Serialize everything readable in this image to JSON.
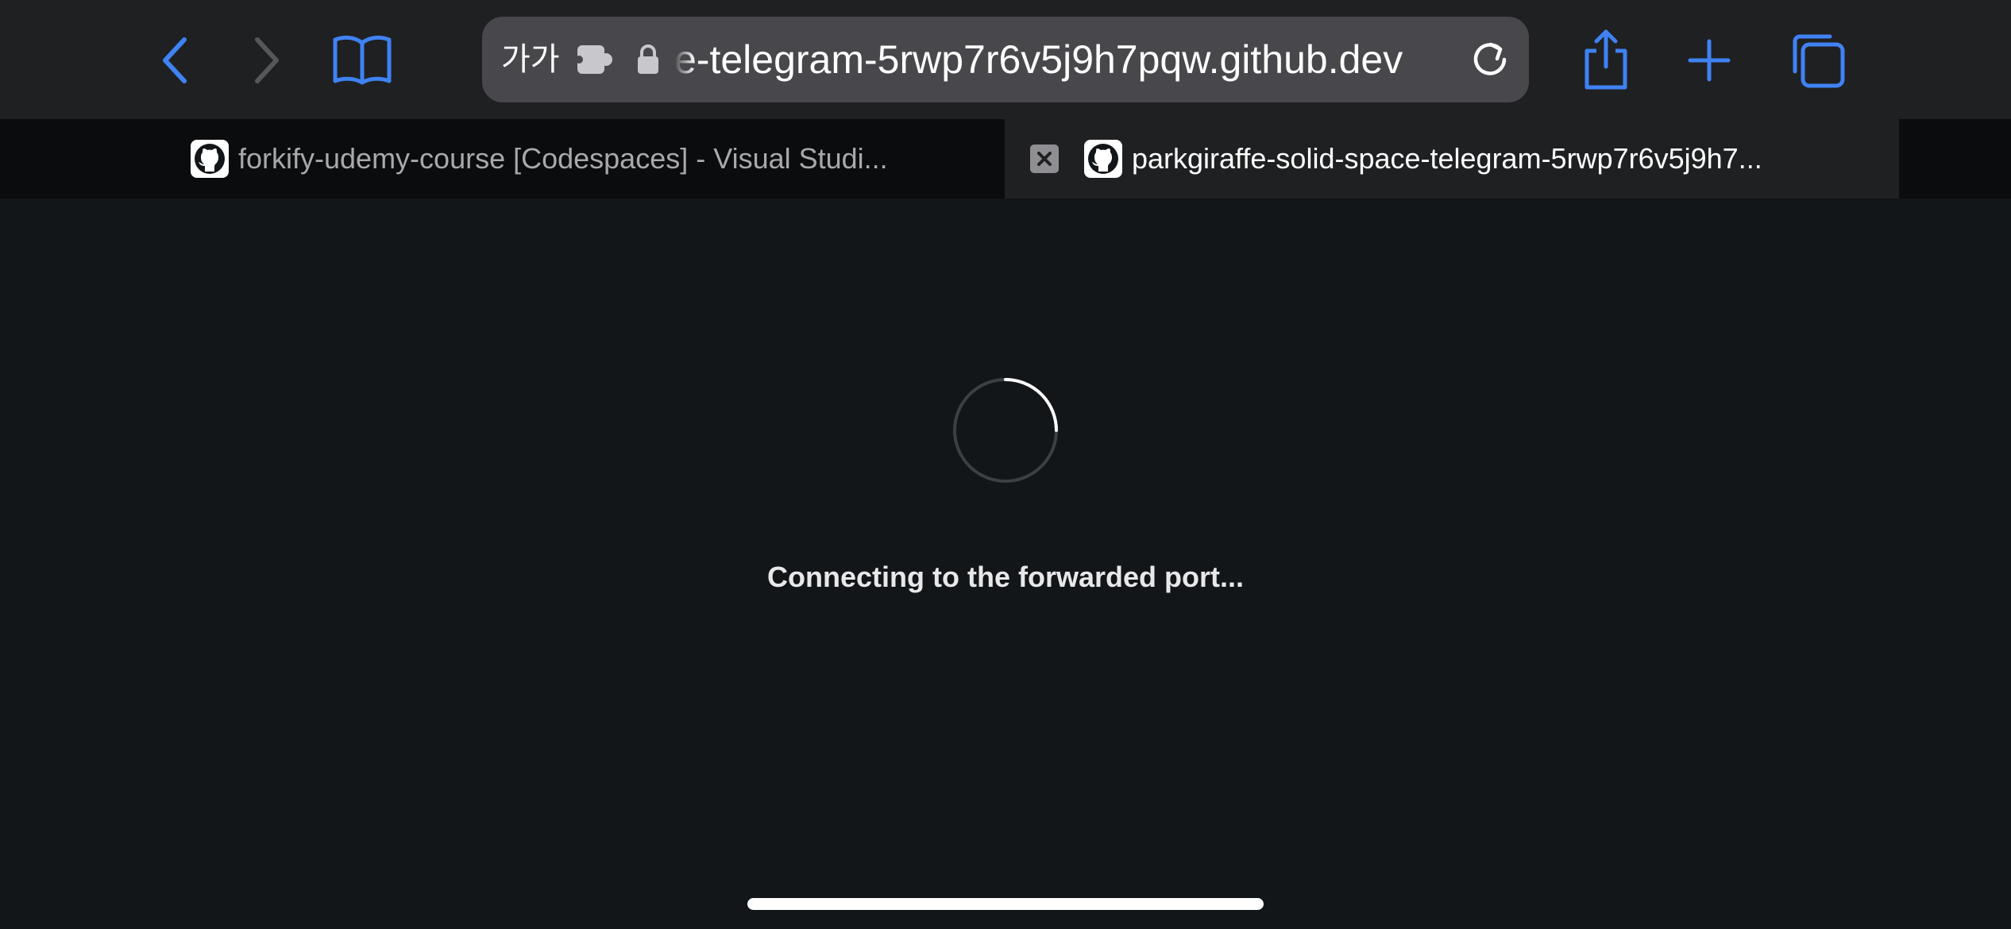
{
  "toolbar": {
    "back_icon": "chevron-left-icon",
    "forward_icon": "chevron-right-icon",
    "bookmarks_icon": "book-icon",
    "share_icon": "share-icon",
    "new_tab_icon": "plus-icon",
    "tabs_icon": "tabs-overview-icon",
    "accent_color": "#3f82f4"
  },
  "address_bar": {
    "reader_label": "가가",
    "extension_icon": "puzzle-icon",
    "lock_icon": "lock-icon",
    "url": "e-telegram-5rwp7r6v5j9h7pqw.github.dev",
    "reload_icon": "reload-icon"
  },
  "tabs": [
    {
      "title": "forkify-udemy-course [Codespaces] - Visual Studi...",
      "favicon": "github-icon",
      "active": false
    },
    {
      "title": "parkgiraffe-solid-space-telegram-5rwp7r6v5j9h7...",
      "favicon": "github-icon",
      "close_icon": "close-icon",
      "active": true
    }
  ],
  "main": {
    "status_text": "Connecting to the forwarded port...",
    "spinner": "loading-spinner"
  },
  "colors": {
    "page_background": "#121619",
    "toolbar_background": "#1f2022",
    "url_bar_background": "#48484c"
  }
}
